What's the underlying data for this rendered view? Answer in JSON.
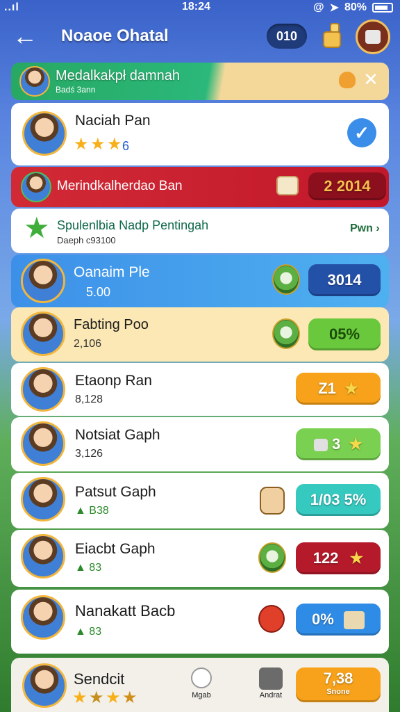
{
  "status": {
    "left": "..ıl ",
    "time": "18:24",
    "battery": "80%"
  },
  "header": {
    "title": "Noaoe Ohatal",
    "counter": "010"
  },
  "banner": {
    "title": "Medalkakpł damnah",
    "subtitle": "Badś 3ann"
  },
  "rows": [
    {
      "name": "Naciah Pan",
      "value": "6"
    },
    {
      "name": "Merindkalherdao Ban",
      "pill": "2 2014"
    },
    {
      "name": "Spulenlbia Nadp Pentingah",
      "sub": "Daeph c93100",
      "link": "Pwn"
    },
    {
      "name": "Oanaim Ple",
      "sub": "5.00",
      "pill": "3014"
    },
    {
      "name": "Fabting Poo",
      "sub": "2,106",
      "pill": "05%"
    },
    {
      "name": "Etaonp Ran",
      "sub": "8,128",
      "pill": "Z1"
    },
    {
      "name": "Notsiat Gaph",
      "sub": "3,126",
      "pill": "3"
    },
    {
      "name": "Patsut Gaph",
      "sub": "B38",
      "pill": "1/03 5%"
    },
    {
      "name": "Eiacbt Gaph",
      "sub": "83",
      "pill": "122"
    },
    {
      "name": "Nanakatt Bacb",
      "sub": "83",
      "pill": "0%"
    }
  ],
  "footer": {
    "name": "Sendcit",
    "nav1": "Mgab",
    "nav2": "Andrat",
    "score": "7,38",
    "score_label": "Snone"
  },
  "colors": {
    "gold": "#f5b400",
    "blue": "#3a8de8",
    "red": "#c2182b",
    "green": "#5cc23a",
    "orange": "#f7a21a"
  }
}
